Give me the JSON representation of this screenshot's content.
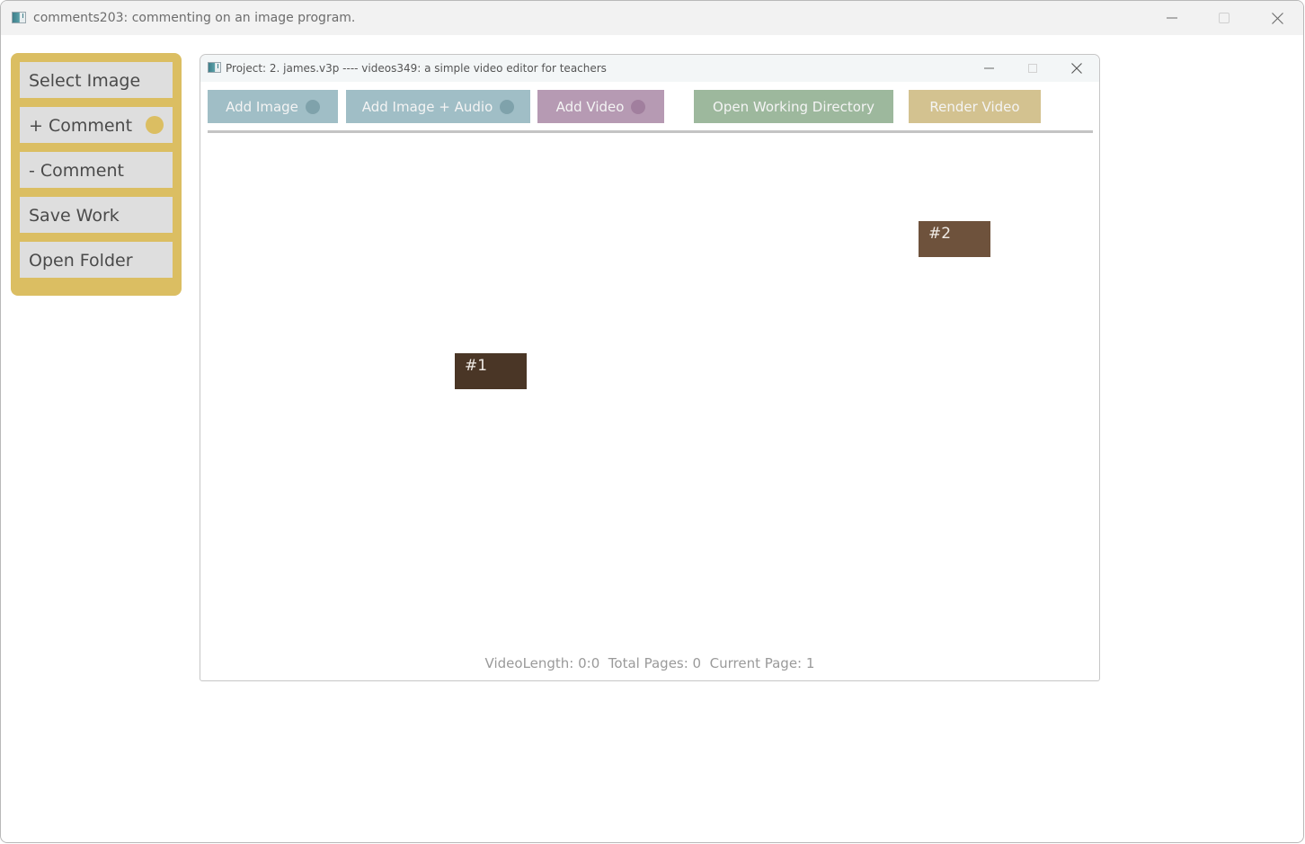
{
  "outer_window": {
    "title": "comments203: commenting on an image program.",
    "controls": {
      "minimize": "minimize",
      "maximize": "maximize",
      "close": "close"
    }
  },
  "sidebar": {
    "accent_color": "#dbbe62",
    "buttons": [
      {
        "label": "Select Image",
        "has_indicator": false
      },
      {
        "label": "+ Comment",
        "has_indicator": true
      },
      {
        "label": "- Comment",
        "has_indicator": false
      },
      {
        "label": "Save Work",
        "has_indicator": false
      },
      {
        "label": "Open Folder",
        "has_indicator": false
      }
    ]
  },
  "inner_window": {
    "title": "Project: 2. james.v3p ---- videos349: a simple video editor for teachers",
    "toolbar": [
      {
        "label": "Add Image",
        "color": "#a0bec6",
        "dot_color": "#7fa2ab"
      },
      {
        "label": "Add Image + Audio",
        "color": "#a0bec6",
        "dot_color": "#7fa2ab"
      },
      {
        "label": "Add Video",
        "color": "#b69ab3",
        "dot_color": "#a17f9e"
      },
      {
        "label": "Open Working Directory",
        "color": "#9db89d"
      },
      {
        "label": "Render Video",
        "color": "#d3c290"
      }
    ],
    "pages": [
      {
        "label": "#1",
        "color": "#4a3626"
      },
      {
        "label": "#2",
        "color": "#6e523c"
      }
    ],
    "status": {
      "video_length_label": "VideoLength:",
      "video_length": "0:0",
      "total_pages_label": "Total Pages:",
      "total_pages": "0",
      "current_page_label": "Current Page:",
      "current_page": "1",
      "text": "VideoLength: 0:0  Total Pages: 0  Current Page: 1"
    }
  }
}
